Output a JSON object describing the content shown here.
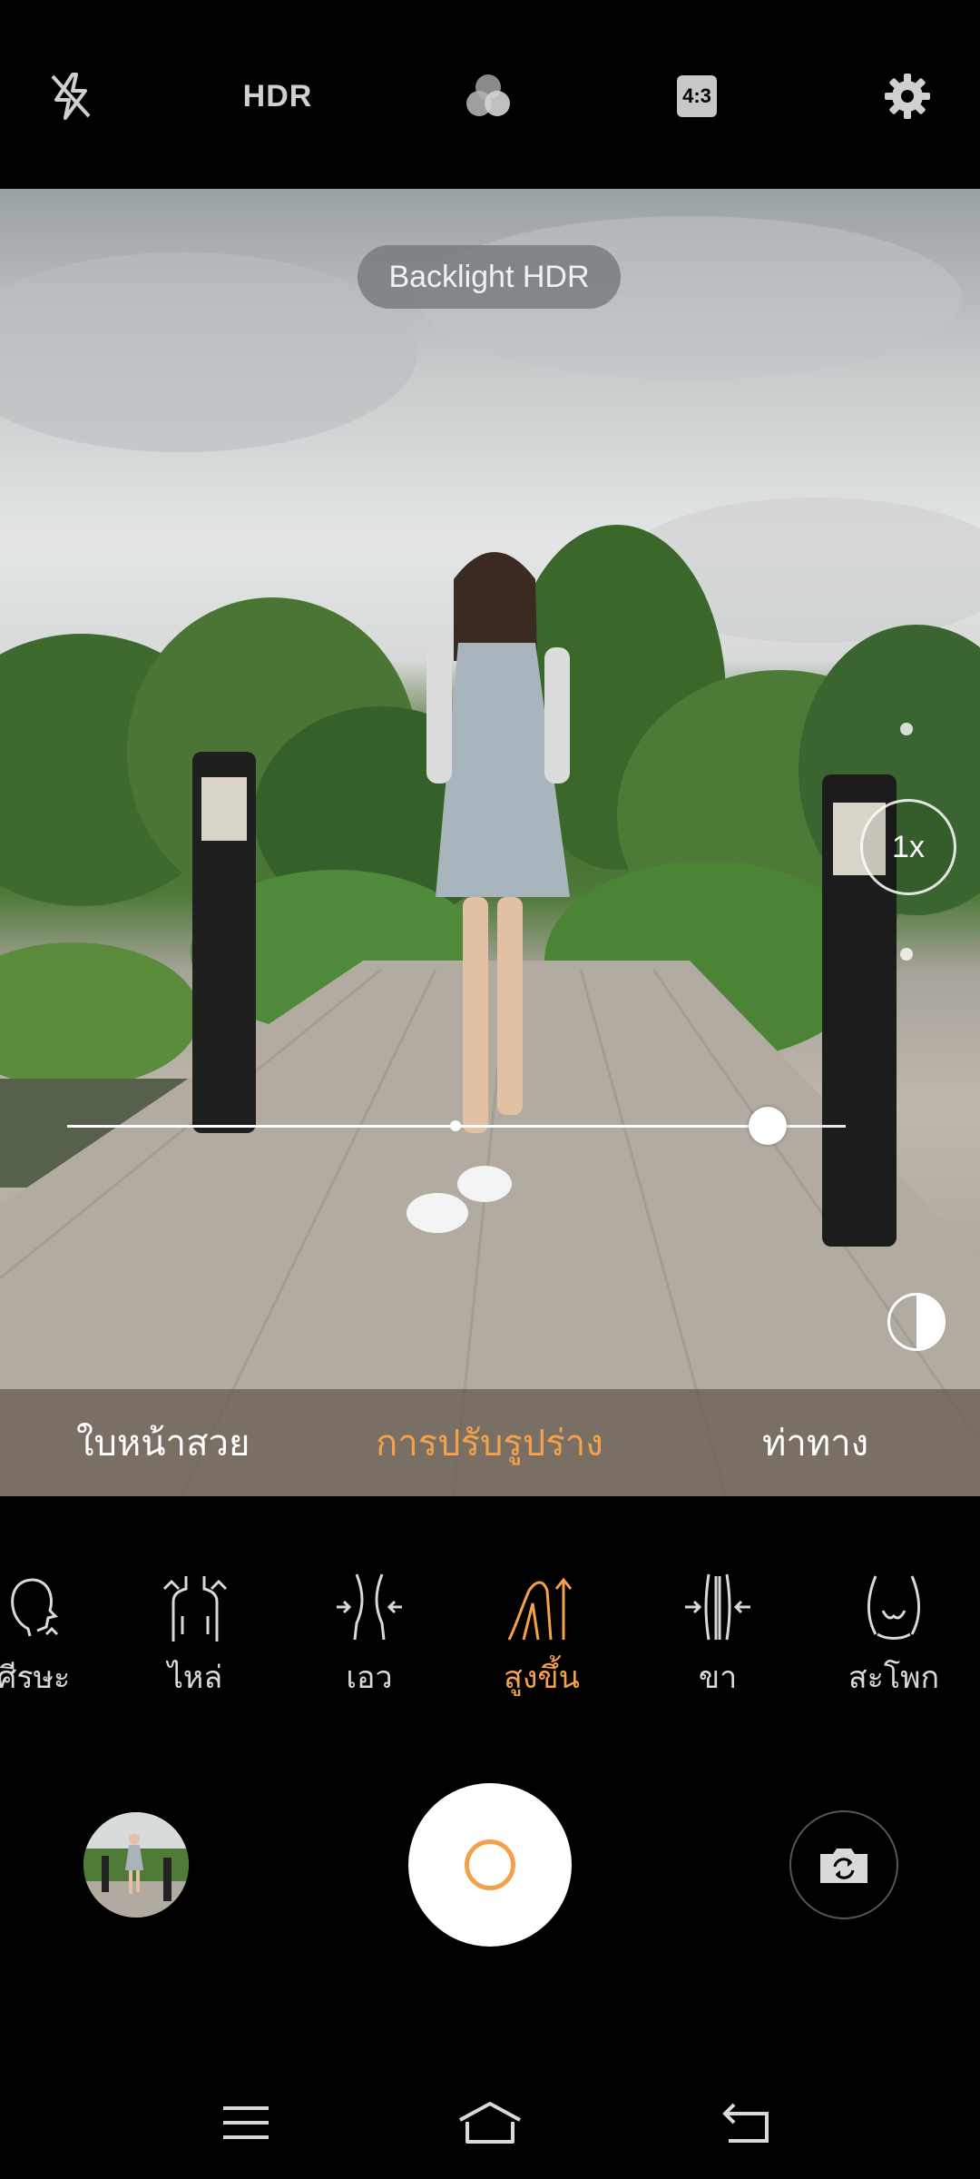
{
  "top_bar": {
    "flash_icon": "flash-off-icon",
    "hdr_label": "HDR",
    "filters_icon": "filters-icon",
    "ratio_label": "4:3",
    "settings_icon": "gear-icon"
  },
  "viewfinder": {
    "hdr_chip": "Backlight HDR",
    "zoom_label": "1x",
    "beauty_slider_level": 0.9,
    "contrast_icon": "contrast-icon"
  },
  "modes": [
    {
      "label": "ใบหน้าสวย",
      "active": false
    },
    {
      "label": "การปรับรูปร่าง",
      "active": true
    },
    {
      "label": "ท่าทาง",
      "active": false
    }
  ],
  "features": [
    {
      "label": "ศีรษะ",
      "icon": "head-icon",
      "active": false
    },
    {
      "label": "ไหล่",
      "icon": "shoulders-icon",
      "active": false
    },
    {
      "label": "เอว",
      "icon": "waist-icon",
      "active": false
    },
    {
      "label": "สูงขึ้น",
      "icon": "taller-icon",
      "active": true
    },
    {
      "label": "ขา",
      "icon": "legs-icon",
      "active": false
    },
    {
      "label": "สะโพก",
      "icon": "hips-icon",
      "active": false
    }
  ],
  "controls": {
    "gallery_icon": "gallery-thumbnail",
    "shutter_icon": "shutter-button",
    "flip_icon": "flip-camera-icon"
  },
  "nav": {
    "menu_icon": "menu-icon",
    "home_icon": "home-icon",
    "back_icon": "back-icon"
  },
  "colors": {
    "accent": "#f5a04b",
    "mode_bar": "#6e6258",
    "background": "#000000"
  }
}
